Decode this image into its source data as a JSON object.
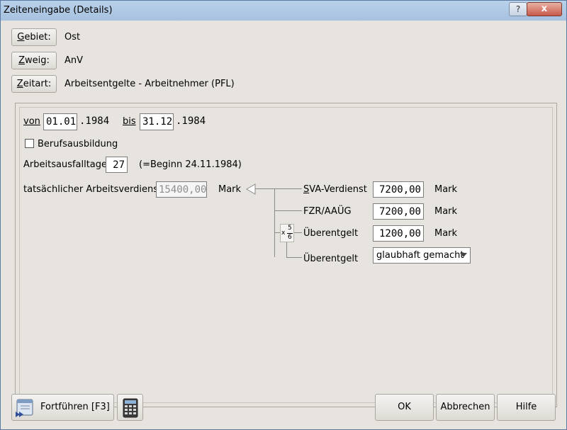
{
  "window": {
    "title": "Zeiteneingabe (Details)",
    "help": "?",
    "close": "x"
  },
  "header": {
    "gebiet": {
      "button": "Gebiet:",
      "value": "Ost"
    },
    "zweig": {
      "button": "Zweig:",
      "value": "AnV"
    },
    "zeitart": {
      "button": "Zeitart:",
      "value": "Arbeitsentgelte  - Arbeitnehmer (PFL)"
    }
  },
  "period": {
    "von_label": "von",
    "von_value": "01.01",
    "von_year": ".1984",
    "bis_label": "bis",
    "bis_value": "31.12",
    "bis_year": ".1984"
  },
  "berufsausbildung": {
    "label": "Berufsausbildung",
    "checked": false
  },
  "ausfall": {
    "label": "Arbeitsausfalltage",
    "value": "27",
    "note": "(=Beginn 24.11.1984)"
  },
  "verdienst": {
    "label": "tatsächlicher Arbeitsverdienst",
    "value": "15400,00",
    "unit": "Mark"
  },
  "sva": {
    "label": "SVA-Verdienst",
    "value": "7200,00",
    "unit": "Mark"
  },
  "fzr": {
    "label": "FZR/AAÜG",
    "value": "7200,00",
    "unit": "Mark"
  },
  "ueber": {
    "label": "Überentgelt",
    "value": "1200,00",
    "unit": "Mark",
    "factor_prefix": "x",
    "factor_num": "5",
    "factor_den": "6"
  },
  "ueber2": {
    "label": "Überentgelt",
    "selected": "glaubhaft gemacht"
  },
  "footer": {
    "fortfuehren": "Fortführen  [F3]",
    "ok": "OK",
    "abbrechen": "Abbrechen",
    "hilfe": "Hilfe"
  }
}
